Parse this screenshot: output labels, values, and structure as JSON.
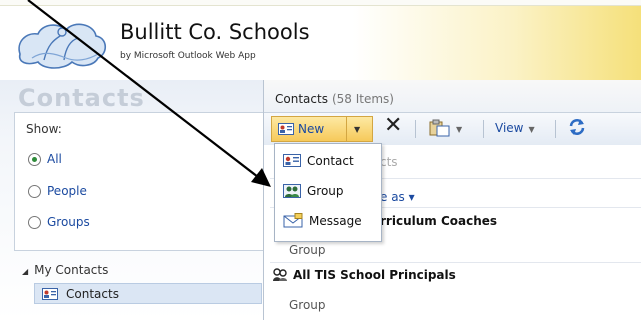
{
  "brand": {
    "title": "Bullitt Co. Schools",
    "subtitle": "by Microsoft Outlook Web App"
  },
  "left": {
    "heading": "Contacts",
    "show_label": "Show:",
    "filters": [
      {
        "label": "All",
        "selected": true
      },
      {
        "label": "People",
        "selected": false
      },
      {
        "label": "Groups",
        "selected": false
      }
    ],
    "tree_root": "My Contacts",
    "tree_item": "Contacts"
  },
  "main": {
    "title": "Contacts",
    "count": "(58 Items)",
    "search_fragment": "cts",
    "arrange_fragment": "e as ▾"
  },
  "toolbar": {
    "new_label": "New",
    "view_label": "View"
  },
  "new_menu": {
    "items": [
      {
        "label": "Contact"
      },
      {
        "label": "Group"
      },
      {
        "label": "Message"
      }
    ]
  },
  "list": {
    "rows": [
      {
        "title_fragment": "rriculum Coaches",
        "subtitle": "Group"
      },
      {
        "title": "All TIS School Principals",
        "subtitle": "Group"
      }
    ]
  },
  "colors": {
    "accent": "#1b4aa0",
    "new_button": "#f6c95a",
    "selection": "#dbe6f4"
  }
}
